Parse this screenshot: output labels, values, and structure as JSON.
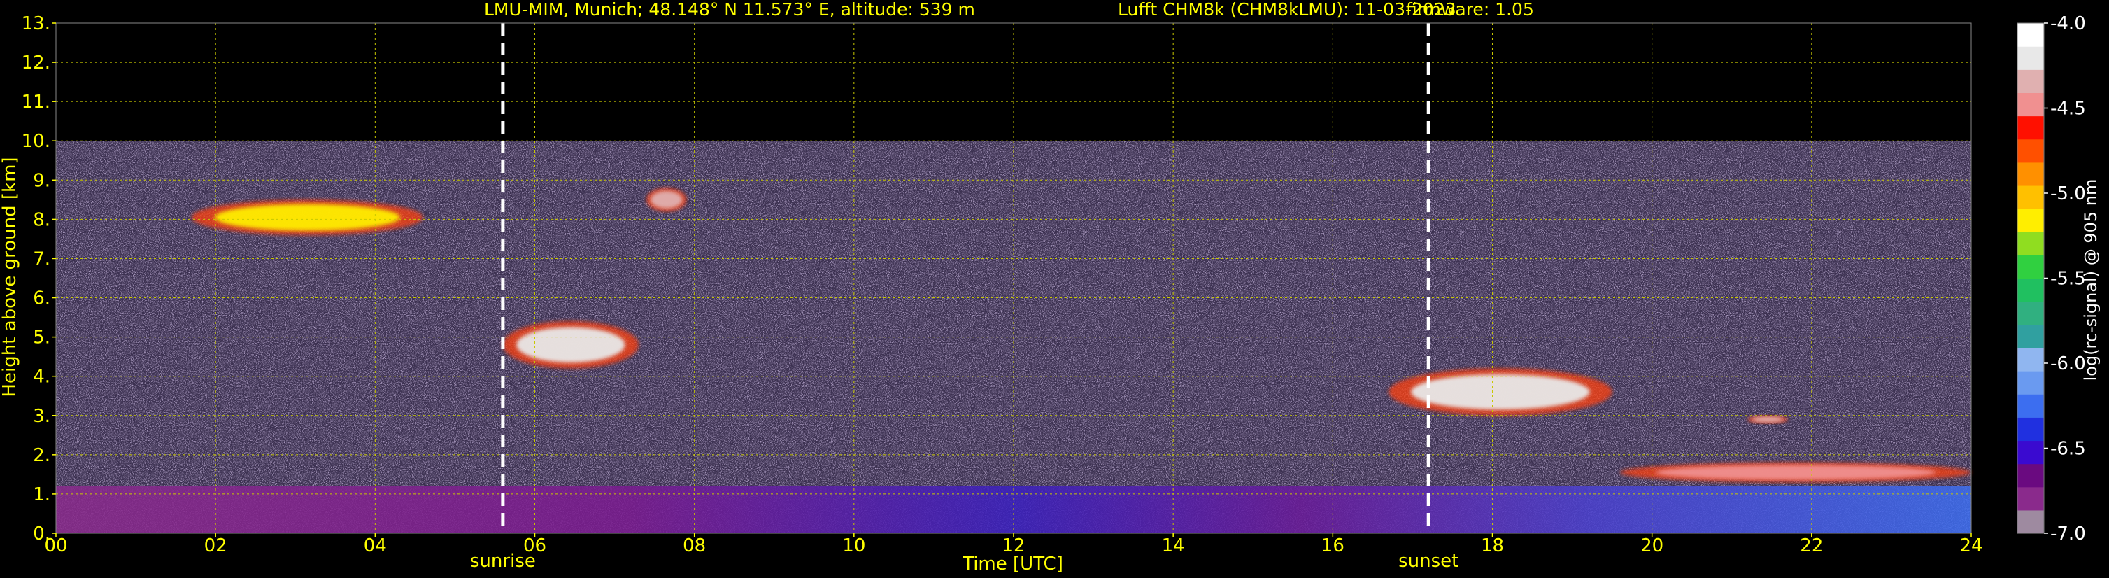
{
  "chart_data": {
    "type": "heatmap",
    "title_left": "LMU-MIM, Munich; 48.148° N 11.573° E, altitude: 539 m",
    "title_mid": "Lufft CHM8k (CHM8kLMU): 11-03-2023",
    "title_right": "firmware: 1.05",
    "xlabel": "Time [UTC]",
    "ylabel": "Height above ground [km]",
    "colorbar_label": "log(rc-signal) @ 905 nm",
    "xlim": [
      0,
      24
    ],
    "ylim": [
      0,
      13
    ],
    "x_ticks": [
      {
        "value": 0,
        "label": "00"
      },
      {
        "value": 2,
        "label": "02"
      },
      {
        "value": 4,
        "label": "04"
      },
      {
        "value": 6,
        "label": "06"
      },
      {
        "value": 8,
        "label": "08"
      },
      {
        "value": 10,
        "label": "10"
      },
      {
        "value": 12,
        "label": "12"
      },
      {
        "value": 14,
        "label": "14"
      },
      {
        "value": 16,
        "label": "16"
      },
      {
        "value": 18,
        "label": "18"
      },
      {
        "value": 20,
        "label": "20"
      },
      {
        "value": 22,
        "label": "22"
      },
      {
        "value": 24,
        "label": "24"
      }
    ],
    "y_ticks": [
      {
        "value": 0,
        "label": "0."
      },
      {
        "value": 1,
        "label": "1."
      },
      {
        "value": 2,
        "label": "2."
      },
      {
        "value": 3,
        "label": "3."
      },
      {
        "value": 4,
        "label": "4."
      },
      {
        "value": 5,
        "label": "5."
      },
      {
        "value": 6,
        "label": "6."
      },
      {
        "value": 7,
        "label": "7."
      },
      {
        "value": 8,
        "label": "8."
      },
      {
        "value": 9,
        "label": "9."
      },
      {
        "value": 10,
        "label": "10."
      },
      {
        "value": 11,
        "label": "11."
      },
      {
        "value": 12,
        "label": "12."
      },
      {
        "value": 13,
        "label": "13."
      }
    ],
    "data_top_km": 10,
    "grid": true,
    "markers": [
      {
        "label": "sunrise",
        "time": 5.6
      },
      {
        "label": "sunset",
        "time": 17.2
      }
    ],
    "colorbar": {
      "range": [
        -7.0,
        -4.0
      ],
      "ticks": [
        {
          "value": -4.0,
          "label": "-4.0"
        },
        {
          "value": -4.5,
          "label": "-4.5"
        },
        {
          "value": -5.0,
          "label": "-5.0"
        },
        {
          "value": -5.5,
          "label": "-5.5"
        },
        {
          "value": -6.0,
          "label": "-6.0"
        },
        {
          "value": -6.5,
          "label": "-6.5"
        },
        {
          "value": -7.0,
          "label": "-7.0"
        }
      ],
      "colors": [
        "#9e8aa0",
        "#8a2a8c",
        "#6a0a80",
        "#3a0ad0",
        "#2030e0",
        "#3c6ef0",
        "#6a9af0",
        "#90b6f0",
        "#30a0a0",
        "#30b080",
        "#20c060",
        "#30d040",
        "#90dd20",
        "#ffee00",
        "#ffc000",
        "#ff9000",
        "#ff5000",
        "#ff1000",
        "#f09090",
        "#e0b0b0",
        "#e8e8e8",
        "#ffffff"
      ]
    },
    "features": [
      {
        "name": "boundary layer aerosol",
        "t0": 0,
        "t1": 24,
        "h0": 0,
        "h1": 1.2,
        "signal": -6.4
      },
      {
        "name": "cirrus",
        "t0": 1.7,
        "t1": 4.6,
        "h0": 7.6,
        "h1": 8.5,
        "signal": -5.1
      },
      {
        "name": "cloud",
        "t0": 5.6,
        "t1": 7.3,
        "h0": 4.2,
        "h1": 5.4,
        "signal": -4.2
      },
      {
        "name": "cloud",
        "t0": 16.7,
        "t1": 19.5,
        "h0": 3.0,
        "h1": 4.2,
        "signal": -4.2
      },
      {
        "name": "cloud",
        "t0": 7.4,
        "t1": 7.9,
        "h0": 8.2,
        "h1": 8.8,
        "signal": -4.3
      },
      {
        "name": "cloud",
        "t0": 21.2,
        "t1": 21.7,
        "h0": 2.8,
        "h1": 3.0,
        "signal": -4.3
      },
      {
        "name": "cloud tops",
        "t0": 19.6,
        "t1": 24,
        "h0": 1.3,
        "h1": 1.8,
        "signal": -4.5
      }
    ]
  }
}
